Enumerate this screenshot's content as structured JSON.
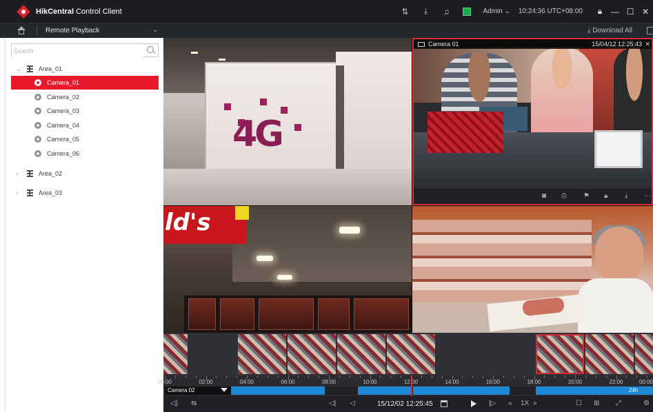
{
  "titlebar": {
    "brand": "HikCentral",
    "brand_suffix": "Control Client",
    "user": "Admin",
    "clock": "10:24:36 UTC+08:00",
    "icons": [
      "sort-icon",
      "download-icon",
      "bell-icon",
      "picture-icon",
      "lock-icon",
      "minimize-icon",
      "maximize-icon",
      "close-icon"
    ]
  },
  "subbar": {
    "module": "Remote Playback",
    "download_all": "Download All"
  },
  "sidebar": {
    "search_placeholder": "Search",
    "areas": [
      {
        "label": "Area_01",
        "expanded": true
      },
      {
        "label": "Area_02",
        "expanded": false
      },
      {
        "label": "Area_03",
        "expanded": false
      }
    ],
    "cameras": [
      "Camera_01",
      "Camera_02",
      "Camera_03",
      "Camera_04",
      "Camera_05",
      "Camera_06"
    ],
    "selected_camera": "Camera_01"
  },
  "grid": {
    "store_text": "4G",
    "sign_text": "ld's",
    "selected_tile": {
      "name": "Camera 01",
      "timestamp": "15/04/12  12:25:43"
    },
    "tile_toolbar_icons": [
      "camera-icon",
      "print-icon",
      "bookmark-icon",
      "lock-icon",
      "download-icon",
      "more-icon"
    ]
  },
  "timeline": {
    "camera_label": "Camera 02",
    "range_label": "24h",
    "hours": [
      "00:00",
      "02:00",
      "04:00",
      "06:00",
      "08:00",
      "10:00",
      "12:00",
      "14:00",
      "16:00",
      "18:00",
      "20:00",
      "22:00",
      "00:00"
    ],
    "current_datetime": "15/12/02  12:25:45",
    "speed": "1X",
    "accent": "#1d88d8",
    "cursor_color": "#e8212d"
  }
}
